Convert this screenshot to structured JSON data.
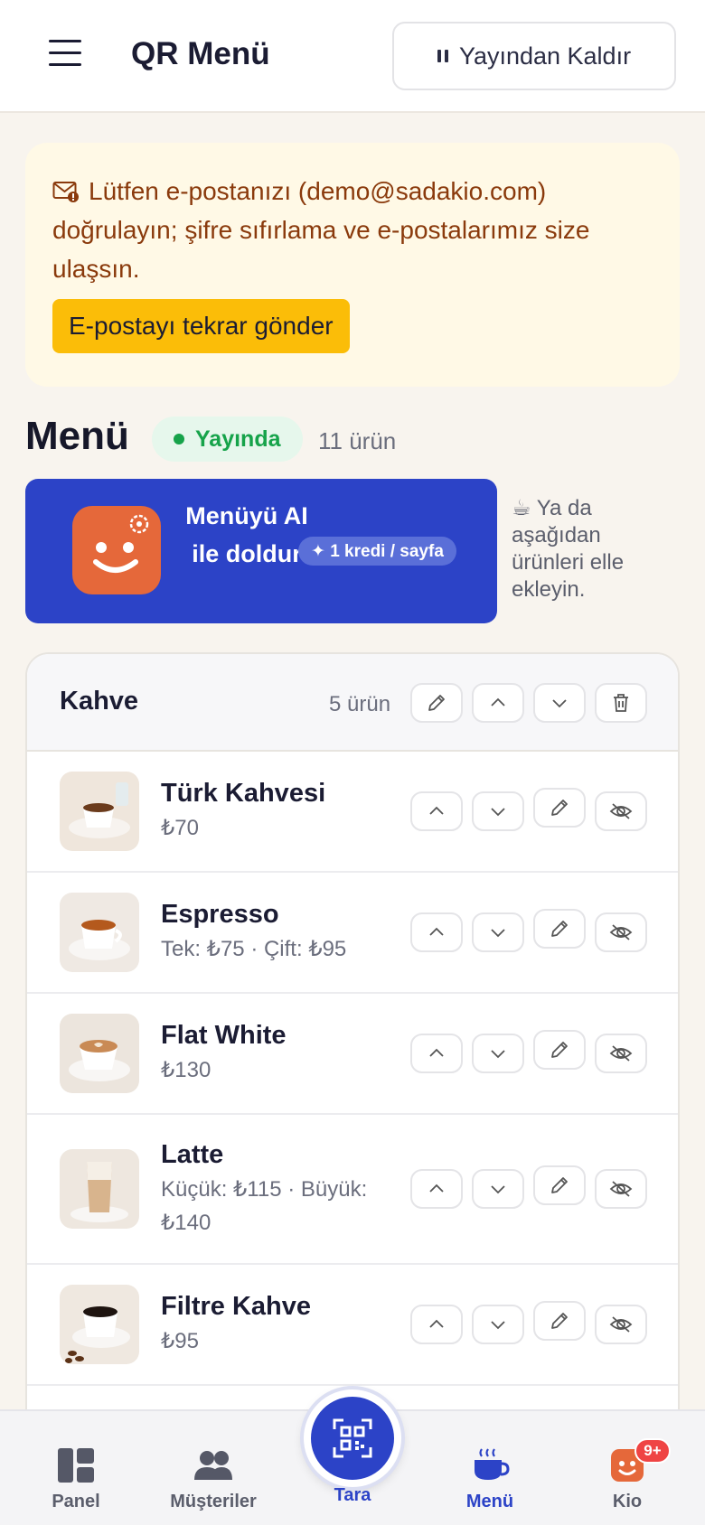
{
  "header": {
    "title": "QR Menü",
    "unpublish_label": "Yayından Kaldır"
  },
  "notice": {
    "message": "Lütfen e-postanızı (demo@sadakio.com) doğrulayın; şifre sıfırlama ve e-postalarımız size ulaşsın.",
    "resend_label": "E-postayı tekrar gönder"
  },
  "menu": {
    "title": "Menü",
    "status": "Yayında",
    "count": "11 ürün",
    "ai_label": "Menüyü AI ile doldur",
    "credit_label": "✦ 1 kredi / sayfa",
    "side_hint": "☕ Ya da aşağıdan ürünleri elle ekleyin."
  },
  "category": {
    "name": "Kahve",
    "count": "5 ürün",
    "items": [
      {
        "name": "Türk Kahvesi",
        "price": "₺70"
      },
      {
        "name": "Espresso",
        "price": "Tek: ₺75 · Çift: ₺95"
      },
      {
        "name": "Flat White",
        "price": "₺130"
      },
      {
        "name": "Latte",
        "price": "Küçük: ₺115 · Büyük: ₺140"
      },
      {
        "name": "Filtre Kahve",
        "price": "₺95"
      }
    ]
  },
  "nav": {
    "panel": "Panel",
    "customers": "Müşteriler",
    "scan": "Tara",
    "menu": "Menü",
    "kio": "Kio",
    "kio_badge": "9+"
  },
  "colors": {
    "accent": "#2c43c7",
    "warning_bg": "#fff9e6",
    "warning_text": "#8a3a0c",
    "success": "#16a34a",
    "mascot": "#e5683a"
  }
}
